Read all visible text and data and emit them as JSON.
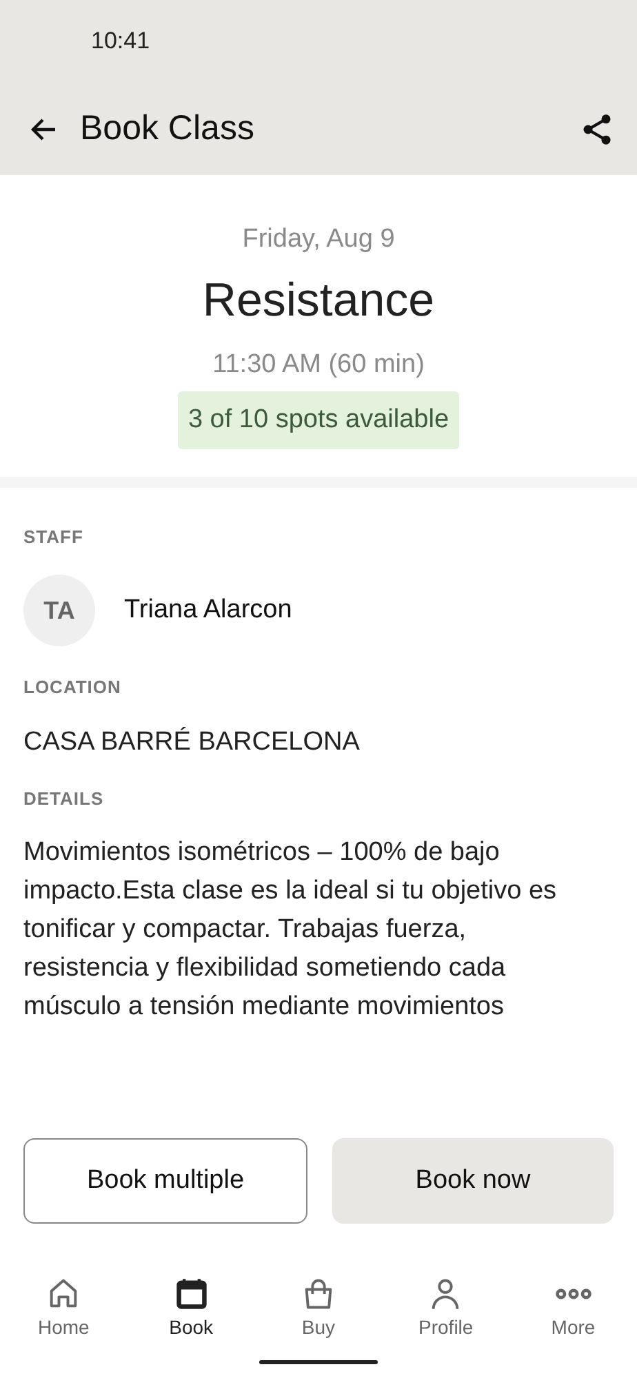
{
  "status_bar": {
    "time": "10:41"
  },
  "header": {
    "title": "Book Class"
  },
  "class": {
    "date": "Friday, Aug 9",
    "name": "Resistance",
    "time": "11:30 AM (60 min)",
    "availability": "3 of 10 spots available"
  },
  "staff": {
    "label": "STAFF",
    "initials": "TA",
    "name": "Triana Alarcon"
  },
  "location": {
    "label": "LOCATION",
    "name": "CASA BARRÉ BARCELONA"
  },
  "details": {
    "label": "DETAILS",
    "text": "Movimientos isométricos – 100% de bajo impacto.Esta clase es la ideal si tu objetivo es tonificar y compactar. Trabajas fuerza, resistencia y flexibilidad sometiendo cada músculo a tensión mediante movimientos"
  },
  "buttons": [
    {
      "label": "Book multiple",
      "kind": "outline"
    },
    {
      "label": "Book now",
      "kind": "filled"
    }
  ],
  "nav": [
    {
      "label": "Home",
      "kind": "home",
      "selected": false
    },
    {
      "label": "Book",
      "kind": "calendar",
      "selected": true
    },
    {
      "label": "Buy",
      "kind": "bag",
      "selected": false
    },
    {
      "label": "Profile",
      "kind": "person",
      "selected": false
    },
    {
      "label": "More",
      "kind": "more",
      "selected": false
    }
  ]
}
